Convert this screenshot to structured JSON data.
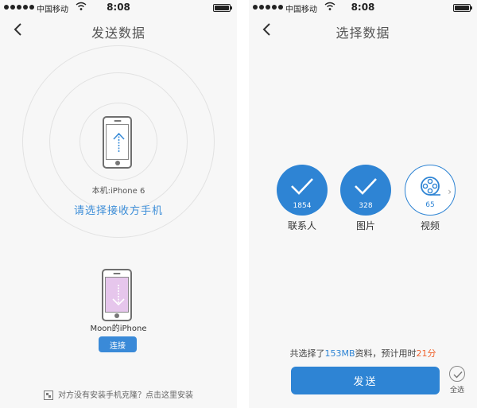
{
  "status_bar": {
    "carrier": "中国移动",
    "time": "8:08"
  },
  "send_screen": {
    "title": "发送数据",
    "local_device": "本机:iPhone 6",
    "prompt": "请选择接收方手机",
    "peer_device": "Moon的iPhone",
    "connect_label": "连接",
    "install_hint": "对方没有安装手机克隆？点击这里安装"
  },
  "select_screen": {
    "title": "选择数据",
    "categories": [
      {
        "name": "联系人",
        "count": "1854",
        "selected": true
      },
      {
        "name": "图片",
        "count": "328",
        "selected": true
      },
      {
        "name": "视频",
        "count": "65",
        "selected": false
      }
    ],
    "summary": {
      "prefix": "共选择了",
      "size": "153MB",
      "middle": "资料，预计用时",
      "duration": "21分"
    },
    "send_label": "发送",
    "select_all_label": "全选"
  },
  "colors": {
    "accent": "#2e84d4",
    "highlight": "#f0632e",
    "peer_phone_screen": "#e6c6ec"
  }
}
